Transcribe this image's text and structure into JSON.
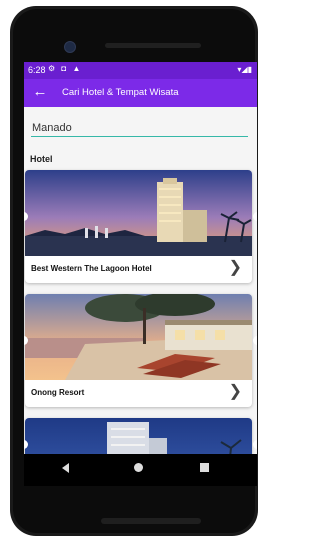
{
  "status_bar": {
    "time": "6:28",
    "icons": [
      "settings-icon",
      "shield-icon",
      "lock-icon"
    ],
    "right": "▾◢▮"
  },
  "app_bar": {
    "back_icon": "arrow-left-icon",
    "title": "Cari Hotel & Tempat Wisata"
  },
  "search": {
    "value": "Manado"
  },
  "section": {
    "label": "Hotel"
  },
  "hotels": [
    {
      "name": "Best Western The Lagoon Hotel"
    },
    {
      "name": "Onong Resort"
    },
    {
      "name": ""
    }
  ],
  "colors": {
    "status_bar": "#6a1fd0",
    "app_bar": "#7c2ae8",
    "input_underline": "#36b8a8"
  }
}
